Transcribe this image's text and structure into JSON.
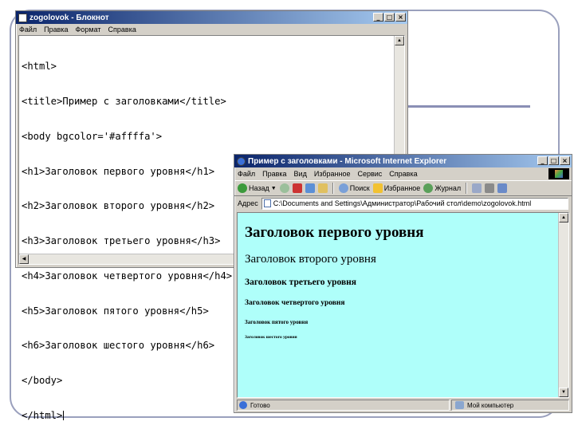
{
  "notepad": {
    "title": "zogolovok - Блокнот",
    "menu": [
      "Файл",
      "Правка",
      "Формат",
      "Справка"
    ],
    "lines": [
      "<html>",
      "<title>Пример с заголовками</title>",
      "<body bgcolor='#affffa'>",
      "<h1>Заголовок первого уровня</h1>",
      "<h2>Заголовок второго уровня</h2>",
      "<h3>Заголовок третьего уровня</h3>",
      "<h4>Заголовок четвертого уровня</h4>",
      "<h5>Заголовок пятого уровня</h5>",
      "<h6>Заголовок шестого уровня</h6>",
      "</body>",
      "</html>"
    ]
  },
  "browser": {
    "title": "Пример с заголовками - Microsoft Internet Explorer",
    "menu": [
      "Файл",
      "Правка",
      "Вид",
      "Избранное",
      "Сервис",
      "Справка"
    ],
    "toolbar": {
      "back": "Назад",
      "search": "Поиск",
      "favorites": "Избранное",
      "media": "Журнал"
    },
    "address_label": "Адрес",
    "address_value": "C:\\Documents and Settings\\Администратор\\Рабочий стол\\demo\\zogolovok.html",
    "background_color": "#affffa",
    "headings": {
      "h1": "Заголовок первого уровня",
      "h2": "Заголовок второго уровня",
      "h3": "Заголовок третьего уровня",
      "h4": "Заголовок четвертого уровня",
      "h5": "Заголовок пятого уровня",
      "h6": "Заголовок шестого уровня"
    },
    "status_left": "Готово",
    "status_right": "Мой компьютер"
  },
  "colors": {
    "titlebar_active": "#0a246a",
    "window_face": "#d4d0c8",
    "page_background": "#affffa",
    "slide_accent": "#9aa0bd"
  },
  "window_buttons": [
    "_",
    "□",
    "×"
  ]
}
